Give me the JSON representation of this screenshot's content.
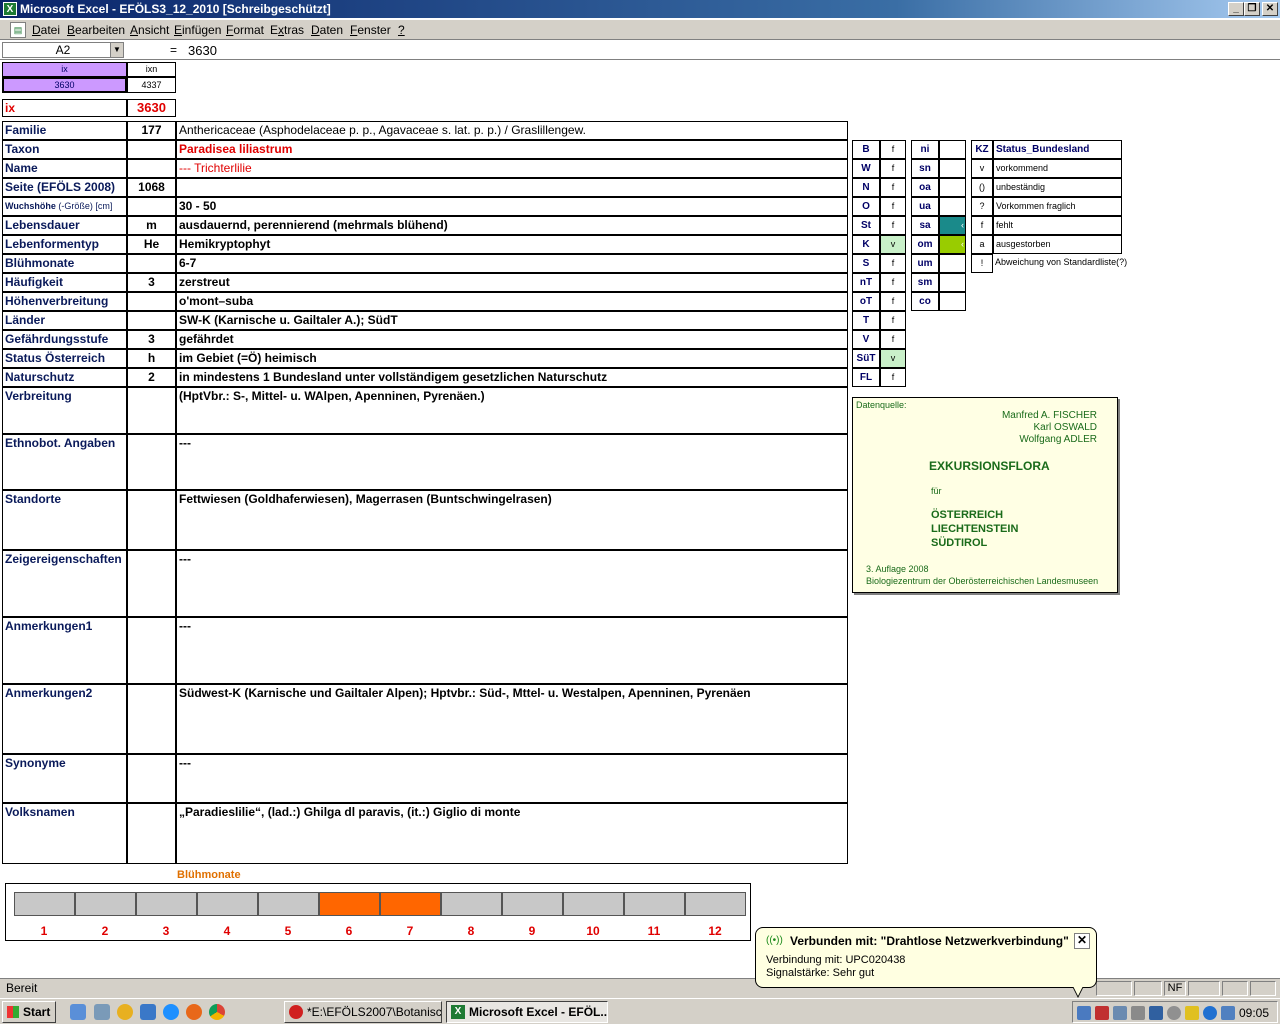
{
  "window": {
    "title": "Microsoft Excel - EFÖLS3_12_2010  [Schreibgeschützt]",
    "minimize": "_",
    "restore": "❐",
    "close": "✕"
  },
  "menu": [
    {
      "pre": "",
      "u": "D",
      "post": "atei"
    },
    {
      "pre": "",
      "u": "B",
      "post": "earbeiten"
    },
    {
      "pre": "",
      "u": "A",
      "post": "nsicht"
    },
    {
      "pre": "",
      "u": "E",
      "post": "infügen"
    },
    {
      "pre": "",
      "u": "F",
      "post": "ormat"
    },
    {
      "pre": "E",
      "u": "x",
      "post": "tras"
    },
    {
      "pre": "",
      "u": "D",
      "post": "aten"
    },
    {
      "pre": "",
      "u": "F",
      "post": "enster"
    },
    {
      "pre": "",
      "u": "?",
      "post": ""
    }
  ],
  "formula": {
    "namebox": "A2",
    "equals": "=",
    "value": "3630"
  },
  "top": {
    "ix_header": "ix",
    "ixn_header": "ixn",
    "ix_value": "3630",
    "ixn_value": "4337",
    "ix_label": "ix",
    "ix_big": "3630"
  },
  "rows": [
    {
      "label": "Familie",
      "code": "177",
      "value": "Anthericaceae (Asphodelaceae p. p., Agavaceae s. lat. p. p.)  /  Graslillengew."
    },
    {
      "label": "Taxon",
      "code": "",
      "value": "Paradisea liliastrum"
    },
    {
      "label": "Name",
      "code": "",
      "value": "--- Trichterlilie"
    },
    {
      "label": "Seite (EFÖLS 2008)",
      "code": "1068",
      "value": ""
    },
    {
      "label": "Wuchshöhe",
      "label_small": "(-Größe) [cm]",
      "code": "",
      "value": " 30 - 50"
    },
    {
      "label": "Lebensdauer",
      "code": "m",
      "value": "ausdauernd, perennierend (mehrmals blühend)"
    },
    {
      "label": "Lebenformentyp",
      "code": "He",
      "value": "Hemikryptophyt"
    },
    {
      "label": "Blühmonate",
      "code": "",
      "value": " 6-7"
    },
    {
      "label": "Häufigkeit",
      "code": "3",
      "value": "zerstreut"
    },
    {
      "label": "Höhenverbreitung",
      "code": "",
      "value": "o'mont–suba"
    },
    {
      "label": "Länder",
      "code": "",
      "value": "SW-K (Karnische u. Gailtaler A.); SüdT"
    },
    {
      "label": "Gefährdungsstufe",
      "code": "3",
      "value": "gefährdet"
    },
    {
      "label": "Status Österreich",
      "code": "h",
      "value": "im Gebiet (=Ö) heimisch"
    },
    {
      "label": "Naturschutz",
      "code": "2",
      "value": "in mindestens 1 Bundesland unter vollständigem gesetzlichen Naturschutz"
    }
  ],
  "tallrows": [
    {
      "label": "Verbreitung",
      "value": "(HptVbr.: S-, Mittel- u. WAlpen, Apenninen, Pyrenäen.)"
    },
    {
      "label": "Ethnobot. Angaben",
      "value": "---"
    },
    {
      "label": "Standorte",
      "value": "Fettwiesen (Goldhaferwiesen), Magerrasen (Buntschwingelrasen)"
    },
    {
      "label": "Zeigereigenschaften",
      "value": "---"
    },
    {
      "label": "Anmerkungen1",
      "value": "---"
    },
    {
      "label": "Anmerkungen2",
      "value": "Südwest-K (Karnische und Gailtaler Alpen); Hptvbr.: Süd-, Mttel- u. Westalpen, Apenninen, Pyrenäen"
    },
    {
      "label": "Synonyme",
      "value": "---"
    },
    {
      "label": "Volksnamen",
      "value": "„Paradieslilie“, (lad.:) Ghilga dl paravis, (it.:) Giglio di monte"
    }
  ],
  "regions1": [
    {
      "k": "B",
      "v": "f"
    },
    {
      "k": "W",
      "v": "f"
    },
    {
      "k": "N",
      "v": "f"
    },
    {
      "k": "O",
      "v": "f"
    },
    {
      "k": "St",
      "v": "f"
    },
    {
      "k": "K",
      "v": "v"
    },
    {
      "k": "S",
      "v": "f"
    },
    {
      "k": "nT",
      "v": "f"
    },
    {
      "k": "oT",
      "v": "f"
    },
    {
      "k": "T",
      "v": "f"
    },
    {
      "k": "V",
      "v": "f"
    },
    {
      "k": "SüT",
      "v": "v"
    },
    {
      "k": "FL",
      "v": "f"
    }
  ],
  "regions2": [
    {
      "k": "ni",
      "v": ""
    },
    {
      "k": "sn",
      "v": ""
    },
    {
      "k": "oa",
      "v": ""
    },
    {
      "k": "ua",
      "v": ""
    },
    {
      "k": "sa",
      "v": "‹"
    },
    {
      "k": "om",
      "v": "‹"
    },
    {
      "k": "um",
      "v": ""
    },
    {
      "k": "sm",
      "v": ""
    },
    {
      "k": "co",
      "v": ""
    }
  ],
  "colors": {
    "sa": "#1a8a8a",
    "om": "#99cc00",
    "highlight": "#c9f0c9",
    "ixcell": "#cc99ff",
    "bar_on": "#ff6600",
    "bar_off": "#c8c8c8"
  },
  "legend": {
    "head_kz": "KZ",
    "head_status": "Status_Bundesland",
    "items": [
      {
        "k": "v",
        "t": "vorkommend"
      },
      {
        "k": "()",
        "t": "unbeständig"
      },
      {
        "k": "?",
        "t": "Vorkommen fraglich"
      },
      {
        "k": "f",
        "t": "fehlt"
      },
      {
        "k": "a",
        "t": "ausgestorben"
      },
      {
        "k": "!",
        "t": "Abweichung von Standardliste(?)"
      }
    ]
  },
  "source": {
    "label": "Datenquelle:",
    "authors": [
      "Manfred A. FISCHER",
      "Karl OSWALD",
      "Wolfgang ADLER"
    ],
    "title": "EXKURSIONSFLORA",
    "fuer": "für",
    "countries": [
      "ÖSTERREICH",
      "LIECHTENSTEIN",
      "SÜDTIROL"
    ],
    "edition": "3. Auflage 2008",
    "publisher": "Biologiezentrum der Oberösterreichischen Landesmuseen"
  },
  "chart_data": {
    "type": "bar",
    "title": "Blühmonate",
    "categories": [
      "1",
      "2",
      "3",
      "4",
      "5",
      "6",
      "7",
      "8",
      "9",
      "10",
      "11",
      "12"
    ],
    "values": [
      0,
      0,
      0,
      0,
      0,
      1,
      1,
      0,
      0,
      0,
      0,
      0
    ]
  },
  "status": {
    "ready": "Bereit",
    "nf": "NF"
  },
  "taskbar": {
    "start": "Start",
    "tasks": [
      "*E:\\EFÖLS2007\\Botanisc...",
      "Microsoft Excel - EFÖL..."
    ],
    "clock": "09:05"
  },
  "balloon": {
    "title": "Verbunden mit: \"Drahtlose Netzwerkverbindung\"",
    "line1": "Verbindung mit: UPC020438",
    "line2": "Signalstärke: Sehr gut",
    "close": "✕",
    "antenna": "((•))"
  }
}
